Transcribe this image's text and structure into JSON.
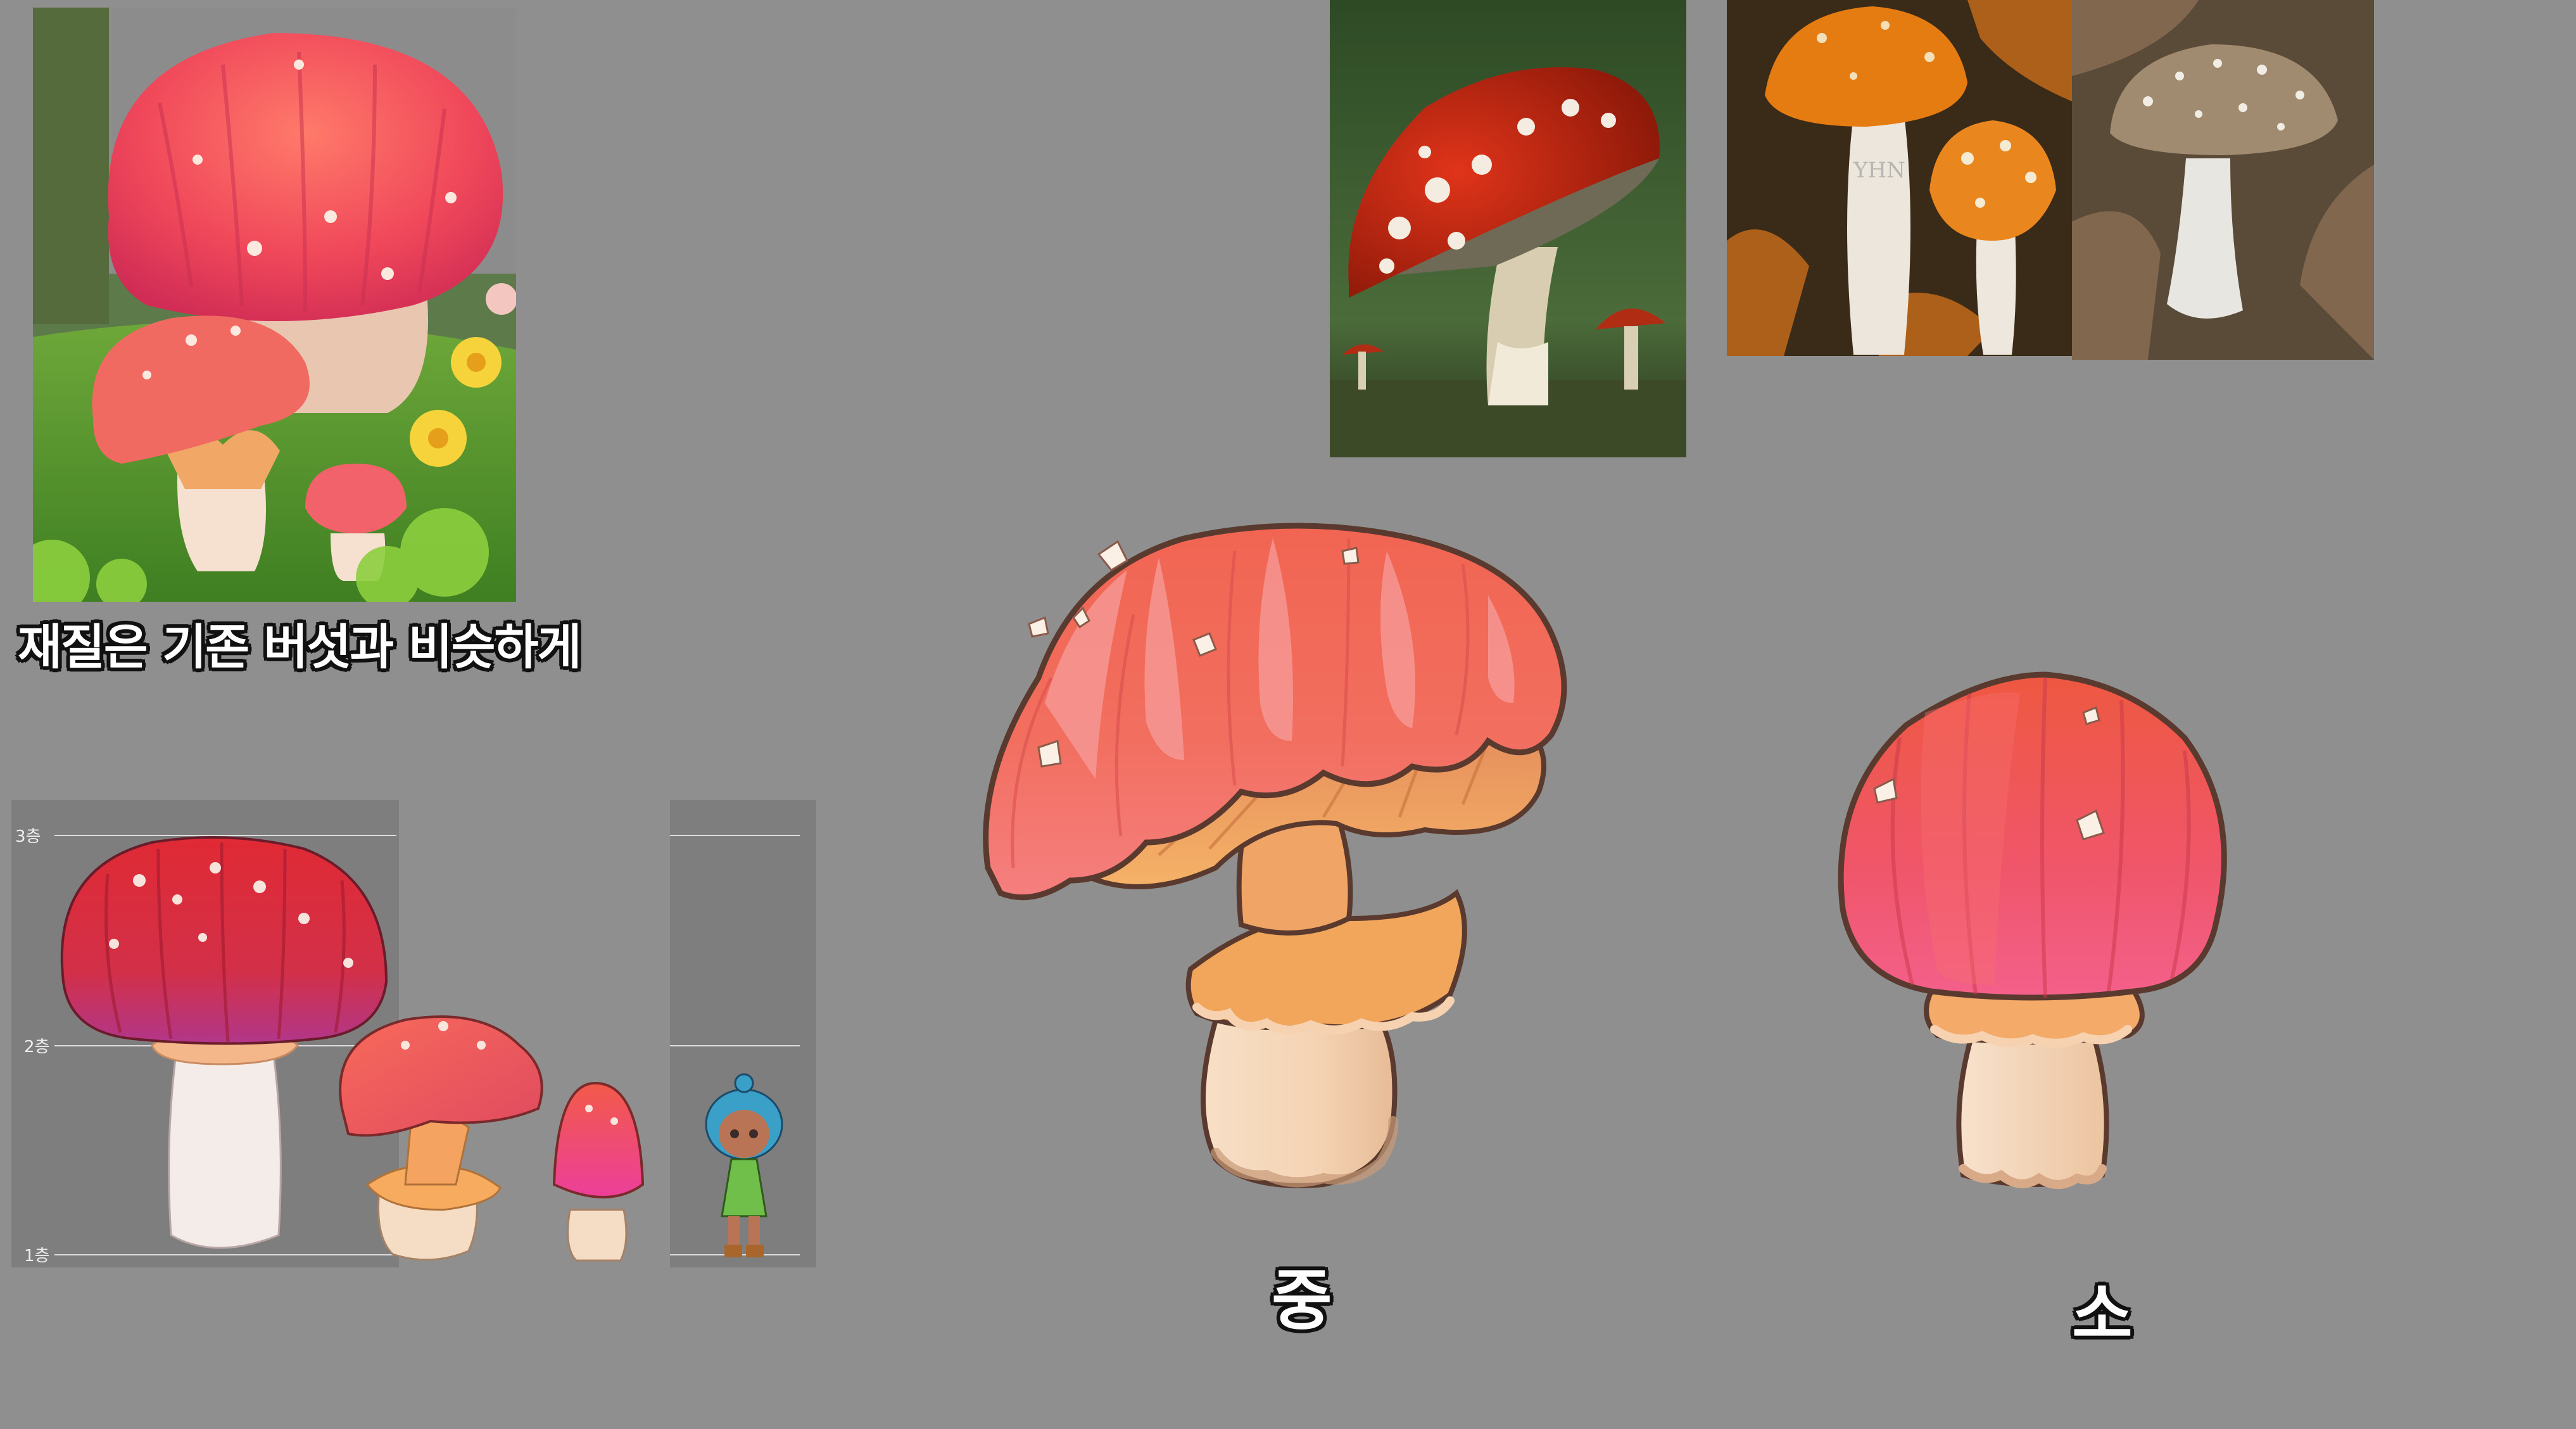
{
  "notes": {
    "material_caption": "재질은 기존 버섯과 비슷하게"
  },
  "size_chart": {
    "scale_labels": [
      "3층",
      "2층",
      "1층"
    ]
  },
  "labels": {
    "medium": "중",
    "small": "소"
  },
  "reference_photos": {
    "watermark": "YHN"
  },
  "colors": {
    "background": "#8f8f8f",
    "cap_red": "#e8494a",
    "cap_pink": "#f47080",
    "gill_orange": "#f2a55a",
    "stem_cream": "#f6d9bf",
    "spot": "#f8efe6"
  }
}
